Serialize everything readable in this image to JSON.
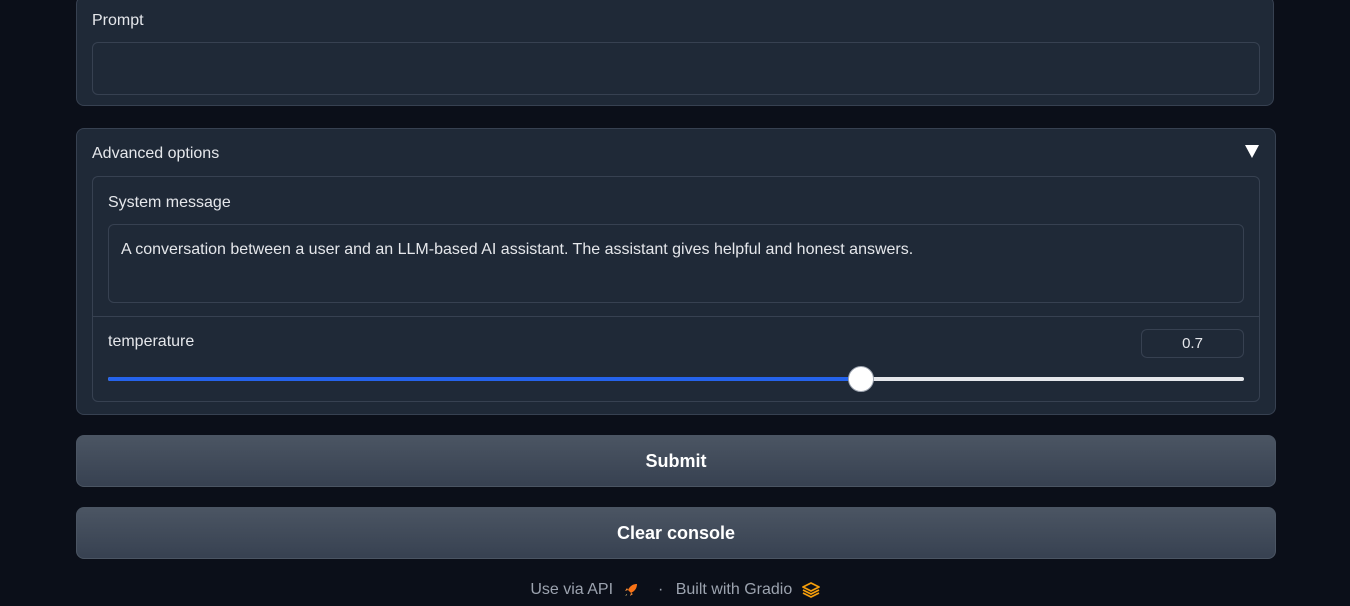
{
  "prompt": {
    "label": "Prompt",
    "value": ""
  },
  "advanced": {
    "title": "Advanced options",
    "system_message": {
      "label": "System message",
      "value": "A conversation between a user and an LLM-based AI assistant. The assistant gives helpful and honest answers."
    },
    "temperature": {
      "label": "temperature",
      "value": "0.7",
      "fraction": 0.663
    }
  },
  "buttons": {
    "submit": "Submit",
    "clear": "Clear console"
  },
  "footer": {
    "api_link": "Use via API",
    "separator": "·",
    "built_with": "Built with Gradio"
  },
  "colors": {
    "background": "#0b0f19",
    "panel": "#1f2937",
    "border": "#374151",
    "slider_fill": "#2563eb",
    "slider_track": "#e5e7eb",
    "rocket": "#f97316",
    "gradio_logo": "#f59e0b"
  }
}
